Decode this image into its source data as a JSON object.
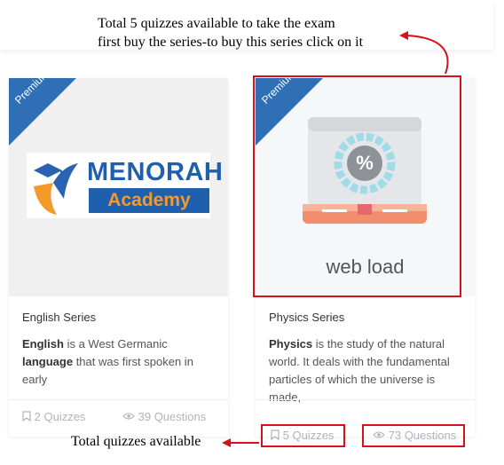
{
  "annotations": {
    "top_line1": "Total 5 quizzes available to take the exam",
    "top_line2": "first buy the series-to buy this series click on it",
    "bottom": "Total quizzes available"
  },
  "cards": [
    {
      "badge": "Premium",
      "logo_title": "MENORAH",
      "logo_subtitle": "Academy",
      "series": "English Series",
      "desc_parts": [
        "English",
        " is a West Germanic ",
        "language",
        " that was first spoken in early"
      ],
      "quizzes": "2 Quizzes",
      "questions": "39 Questions"
    },
    {
      "badge": "Premium",
      "image_caption": "web load",
      "series": "Physics Series",
      "desc_parts": [
        "Physics",
        " is the study of the natural world. It deals with the fundamental particles of which the universe is made,"
      ],
      "quizzes": "5 Quizzes",
      "questions": "73 Questions"
    }
  ],
  "colors": {
    "accent": "#2f6fb5",
    "highlight": "#d4111c",
    "logo_orange": "#f39a2a"
  },
  "icons": [
    "bookmark-icon",
    "eye-icon",
    "graduation-cap-icon",
    "percent-icon",
    "laptop-icon"
  ]
}
